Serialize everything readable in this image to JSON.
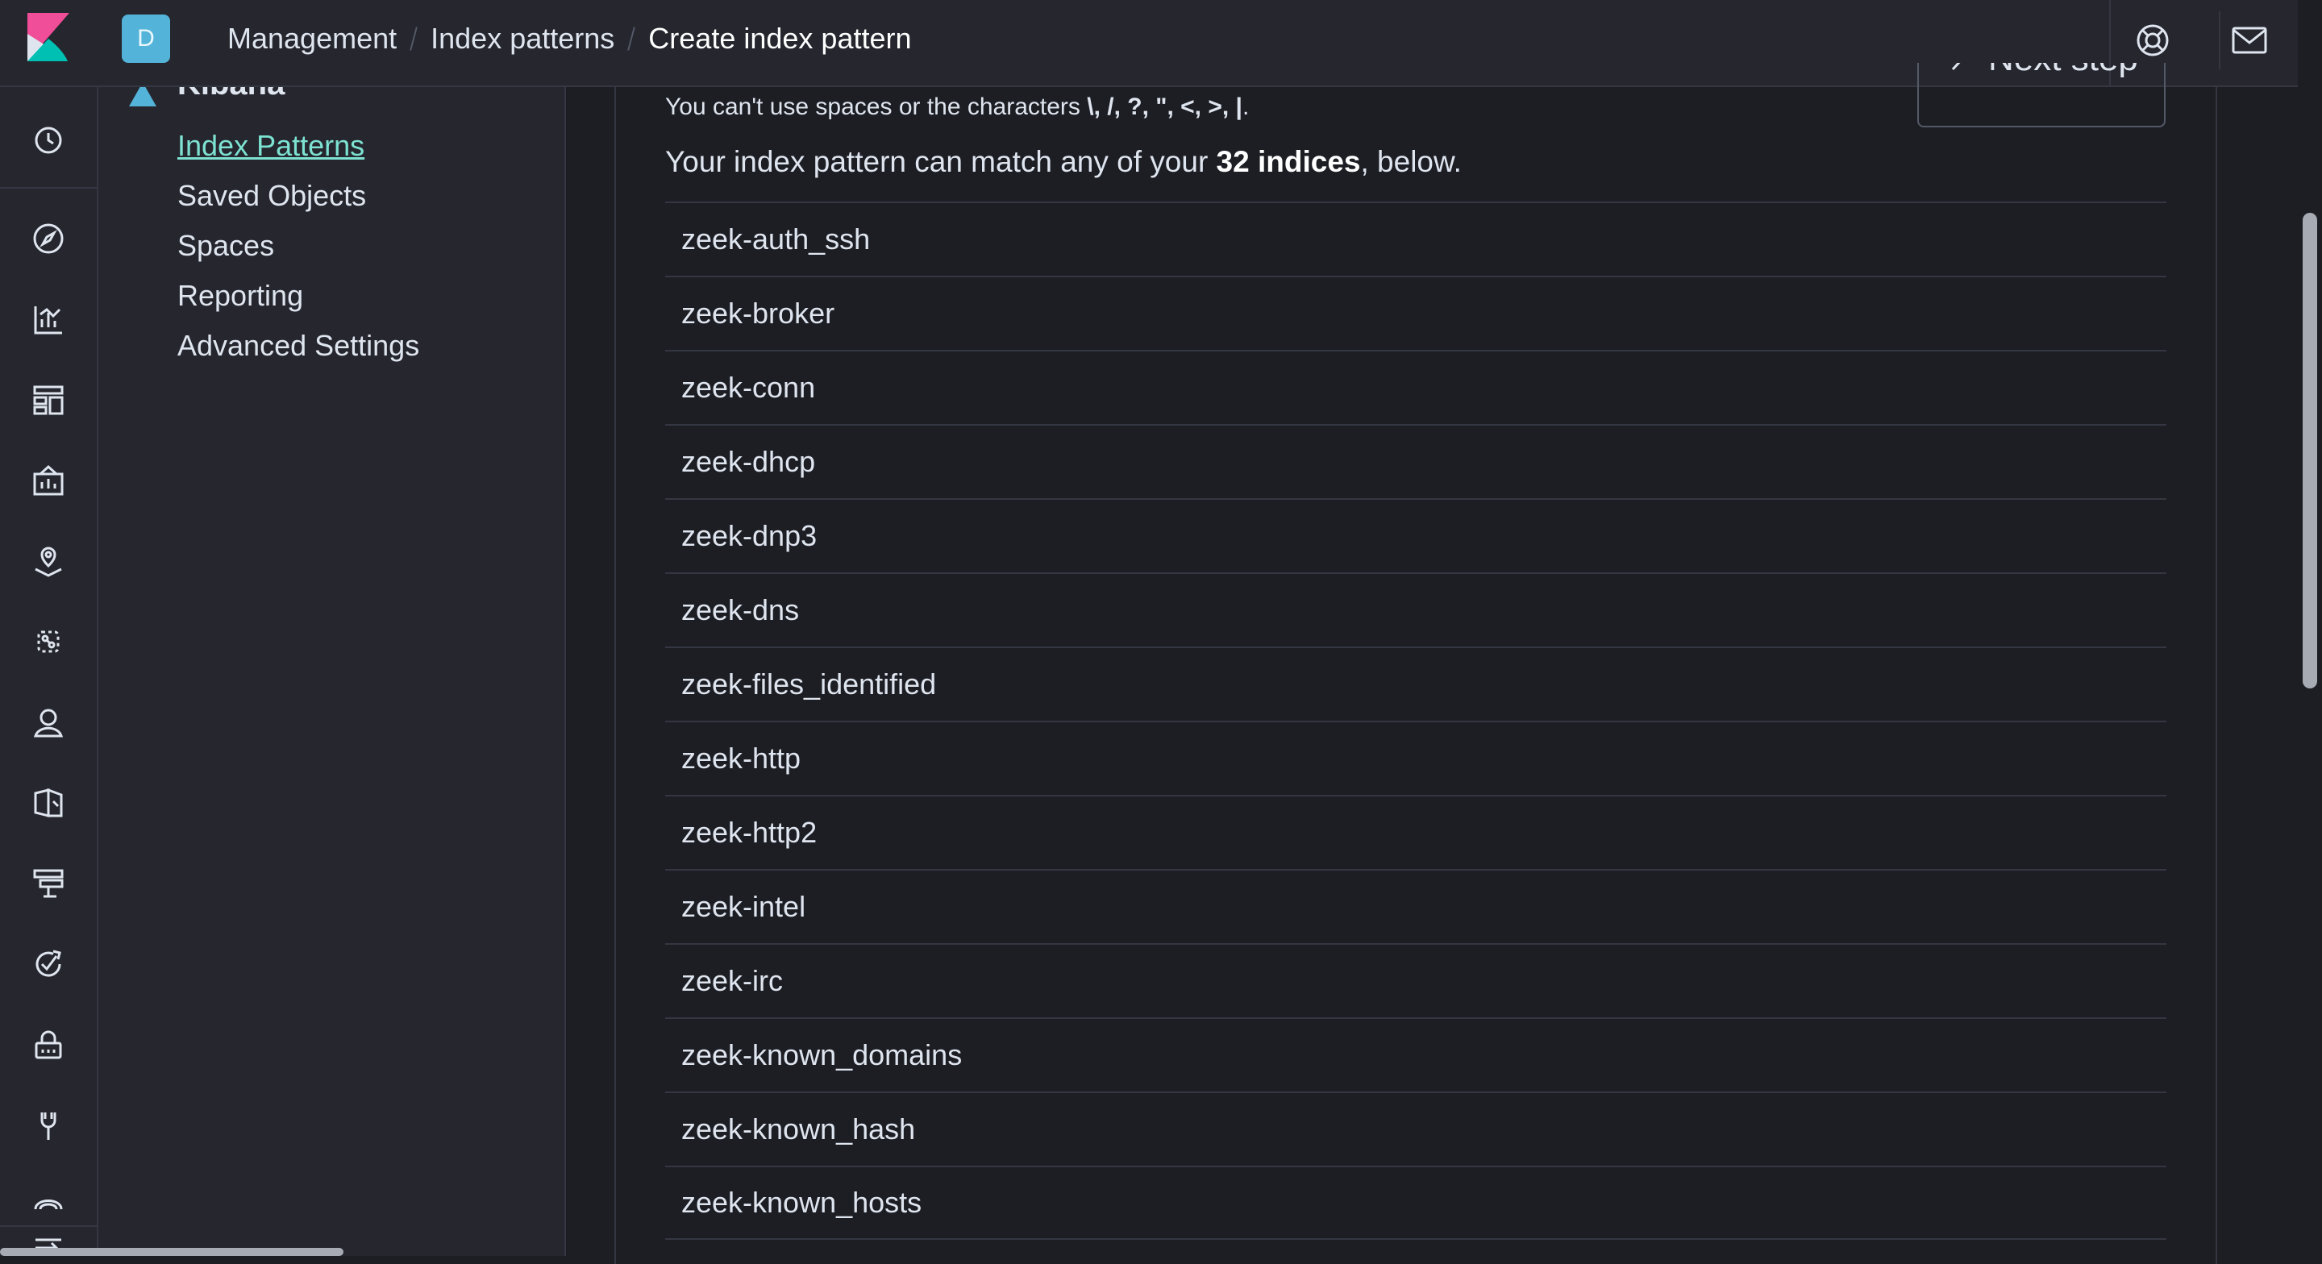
{
  "header": {
    "space_initial": "D",
    "breadcrumbs": [
      "Management",
      "Index patterns",
      "Create index pattern"
    ]
  },
  "nav_rail": {
    "icons": [
      "clock-icon",
      "compass-icon",
      "visualize-icon",
      "dashboard-icon",
      "canvas-icon",
      "maps-icon",
      "ml-icon",
      "infrastructure-icon",
      "logs-icon",
      "apm-icon",
      "uptime-icon",
      "siem-icon",
      "dev-tools-icon",
      "monitoring-icon",
      "collapse-icon"
    ]
  },
  "side_nav": {
    "title": "Kibana",
    "items": [
      "Index Patterns",
      "Saved Objects",
      "Spaces",
      "Reporting",
      "Advanced Settings"
    ],
    "active_index": 0
  },
  "main": {
    "hint_prefix": "You can't use spaces or the characters ",
    "hint_chars": "\\, /, ?, \", <, >, |",
    "hint_suffix": ".",
    "summary_prefix": "Your index pattern can match any of your ",
    "summary_count": "32 indices",
    "summary_suffix": ", below.",
    "next_button_label": "Next step",
    "indices": [
      "zeek-auth_ssh",
      "zeek-broker",
      "zeek-conn",
      "zeek-dhcp",
      "zeek-dnp3",
      "zeek-dns",
      "zeek-files_identified",
      "zeek-http",
      "zeek-http2",
      "zeek-intel",
      "zeek-irc",
      "zeek-known_domains",
      "zeek-known_hash",
      "zeek-known_hosts"
    ]
  },
  "colors": {
    "accent": "#7de2d1",
    "avatar": "#54b3d9",
    "logo_pink": "#f04e98",
    "logo_teal": "#00bfb3",
    "background": "#1d1e24",
    "chrome": "#25262e"
  }
}
